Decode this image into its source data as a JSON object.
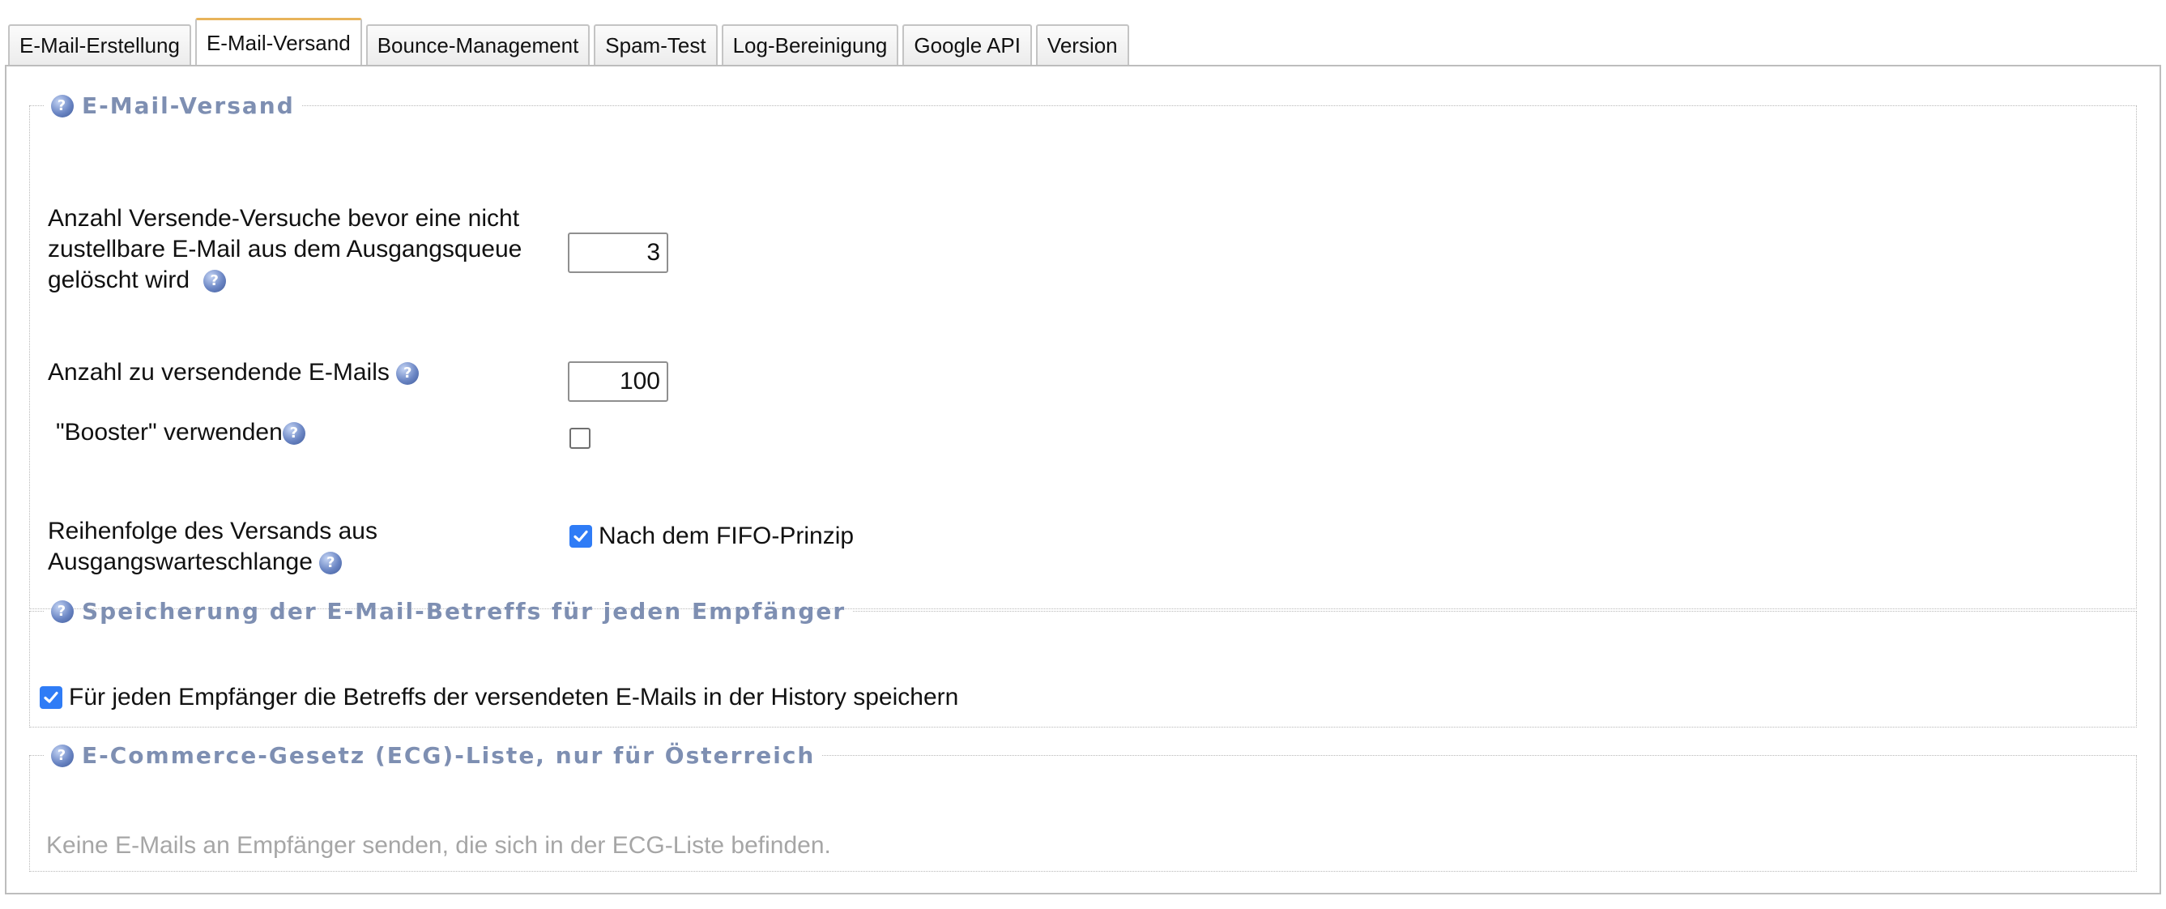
{
  "tabs": [
    {
      "label": "E-Mail-Erstellung",
      "active": false
    },
    {
      "label": "E-Mail-Versand",
      "active": true
    },
    {
      "label": "Bounce-Management",
      "active": false
    },
    {
      "label": "Spam-Test",
      "active": false
    },
    {
      "label": "Log-Bereinigung",
      "active": false
    },
    {
      "label": "Google API",
      "active": false
    },
    {
      "label": "Version",
      "active": false
    }
  ],
  "versand": {
    "legend": "E-Mail-Versand",
    "attempts_label_1": "Anzahl Versende-Versuche bevor eine nicht",
    "attempts_label_2": "zustellbare E-Mail aus dem Ausgangsqueue",
    "attempts_label_3": "gelöscht wird",
    "attempts_value": "3",
    "count_label": "Anzahl zu versendende E-Mails",
    "count_value": "100",
    "booster_label": "\"Booster\" verwenden",
    "booster_checked": false,
    "order_label_1": "Reihenfolge des Versands aus",
    "order_label_2": "Ausgangswarteschlange",
    "fifo_label": "Nach dem FIFO-Prinzip",
    "fifo_checked": true
  },
  "subjects": {
    "legend": "Speicherung der E-Mail-Betreffs für jeden Empfänger",
    "checkbox_label": "Für jeden Empfänger die Betreffs der versendeten E-Mails in der History speichern",
    "checked": true
  },
  "ecg": {
    "legend": "E-Commerce-Gesetz (ECG)-Liste, nur für Österreich",
    "text": "Keine E-Mails an Empfänger senden, die sich in der ECG-Liste befinden."
  },
  "icons": {
    "help": "help-icon",
    "checkmark": "checkmark-icon"
  },
  "colors": {
    "legend": "#7e8fb2",
    "active_tab_top": "#e8b35a",
    "checkbox_checked": "#2f7cf6",
    "muted_text": "#a6a6a6"
  }
}
